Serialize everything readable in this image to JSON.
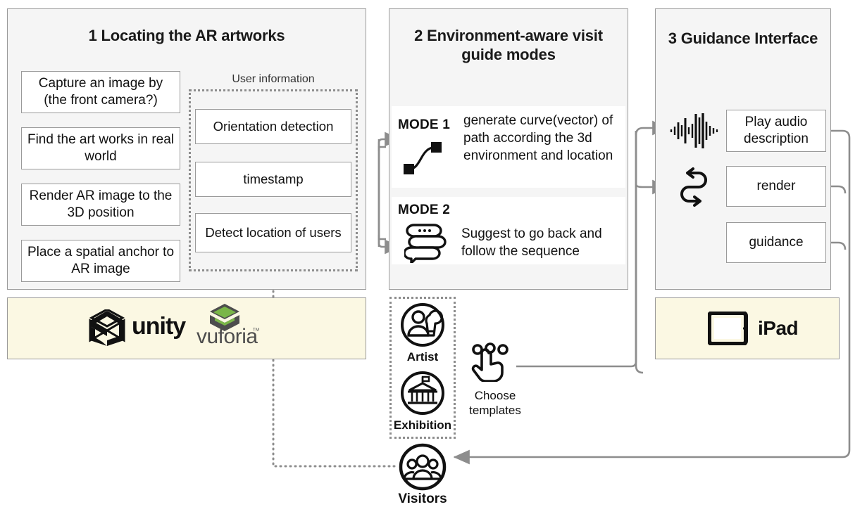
{
  "panels": {
    "p1": {
      "title": "1 Locating the AR artworks"
    },
    "p2": {
      "title": "2 Environment-aware visit guide modes"
    },
    "p3": {
      "title": "3 Guidance Interface"
    }
  },
  "flow_steps": [
    {
      "label": "Capture an image by (the front camera?)"
    },
    {
      "label": "Find the art works in real world"
    },
    {
      "label": "Render AR image to the 3D position"
    },
    {
      "label": "Place a spatial anchor to AR image"
    }
  ],
  "user_information": {
    "caption": "User information",
    "items": [
      {
        "label": "Orientation detection"
      },
      {
        "label": "timestamp"
      },
      {
        "label": "Detect location of users"
      }
    ]
  },
  "modes": [
    {
      "label": "MODE 1",
      "icon": "bezier-curve-icon",
      "text": "generate curve(vector) of path according the 3d environment and location"
    },
    {
      "label": "MODE 2",
      "icon": "speech-bubbles-icon",
      "text": "Suggest to go back and follow the sequence"
    }
  ],
  "guidance_items": [
    {
      "icon": "audio-waveform-icon",
      "label": "Play audio description"
    },
    {
      "icon": "loop-arrows-icon",
      "label": "render"
    },
    {
      "icon": "",
      "label": "guidance"
    }
  ],
  "tech_bar": {
    "unity_label": "unity",
    "vuforia_label": "vuforia",
    "vuforia_tm": "™"
  },
  "device_bar": {
    "ipad_label": "iPad"
  },
  "templates": {
    "items": [
      {
        "icon": "artist-icon",
        "label": "Artist"
      },
      {
        "icon": "museum-icon",
        "label": "Exhibition"
      }
    ],
    "action_label": "Choose templates",
    "action_icon": "tap-hand-icon"
  },
  "visitors": {
    "icon": "people-group-icon",
    "label": "Visitors"
  },
  "colors": {
    "panel_bg": "#f5f5f5",
    "panel_border": "#9a9a9a",
    "box_bg": "#ffffff",
    "cream_bg": "#fbf8e3",
    "wire": "#8d8d8d",
    "dotted": "#8d8d8d",
    "ink": "#111111",
    "vuforia_green": "#7ab648"
  }
}
